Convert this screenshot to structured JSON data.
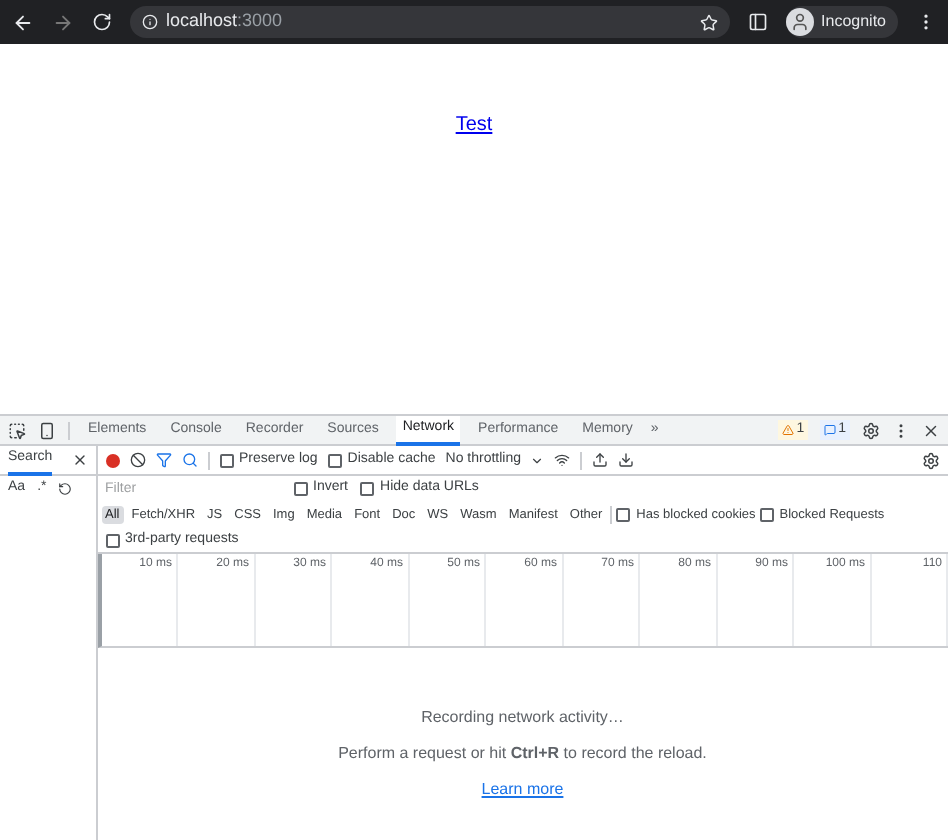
{
  "browser": {
    "address": "localhost",
    "port": ":3000",
    "profile": "Incognito"
  },
  "page": {
    "link": "Test"
  },
  "devtools": {
    "tabs": [
      {
        "label": "Elements",
        "selected": false
      },
      {
        "label": "Console",
        "selected": false
      },
      {
        "label": "Recorder",
        "selected": false
      },
      {
        "label": "Sources",
        "selected": false
      },
      {
        "label": "Network",
        "selected": true
      },
      {
        "label": "Performance",
        "selected": false
      },
      {
        "label": "Memory",
        "selected": false
      }
    ],
    "overflow": "»",
    "warnings": "1",
    "messages": "1"
  },
  "search_panel": {
    "title": "Search",
    "options": [
      "Aa",
      ".*"
    ]
  },
  "toolbar": {
    "recording": true,
    "preserve_log": {
      "label": "Preserve log",
      "checked": false
    },
    "disable_cache": {
      "label": "Disable cache",
      "checked": false
    },
    "throttling": "No throttling"
  },
  "filter": {
    "placeholder": "Filter",
    "invert": {
      "label": "Invert",
      "checked": false
    },
    "hide_data_urls": {
      "label": "Hide data URLs",
      "checked": false
    }
  },
  "types": [
    {
      "label": "All",
      "selected": true
    },
    {
      "label": "Fetch/XHR",
      "selected": false
    },
    {
      "label": "JS",
      "selected": false
    },
    {
      "label": "CSS",
      "selected": false
    },
    {
      "label": "Img",
      "selected": false
    },
    {
      "label": "Media",
      "selected": false
    },
    {
      "label": "Font",
      "selected": false
    },
    {
      "label": "Doc",
      "selected": false
    },
    {
      "label": "WS",
      "selected": false
    },
    {
      "label": "Wasm",
      "selected": false
    },
    {
      "label": "Manifest",
      "selected": false
    },
    {
      "label": "Other",
      "selected": false
    }
  ],
  "extra_filters": [
    {
      "label": "Has blocked cookies",
      "checked": false
    },
    {
      "label": "Blocked Requests",
      "checked": false
    }
  ],
  "third_party": {
    "label": "3rd-party requests",
    "checked": false
  },
  "timeline": {
    "ticks": [
      "10 ms",
      "20 ms",
      "30 ms",
      "40 ms",
      "50 ms",
      "60 ms",
      "70 ms",
      "80 ms",
      "90 ms",
      "100 ms",
      "110"
    ]
  },
  "empty": {
    "title": "Recording network activity…",
    "hint": "Perform a request or hit **Ctrl+R** to record the reload.",
    "link": "Learn more"
  }
}
